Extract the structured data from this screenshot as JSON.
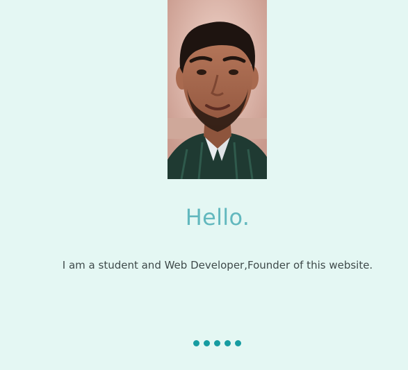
{
  "profile": {
    "greeting": "Hello.",
    "intro": "I am a student and Web Developer,Founder of this website."
  },
  "carousel": {
    "dot_count": 5,
    "active_index": 0
  },
  "colors": {
    "background": "#e4f7f3",
    "greeting": "#62b8be",
    "text": "#3f4a4a",
    "dots": "#179ca1"
  }
}
